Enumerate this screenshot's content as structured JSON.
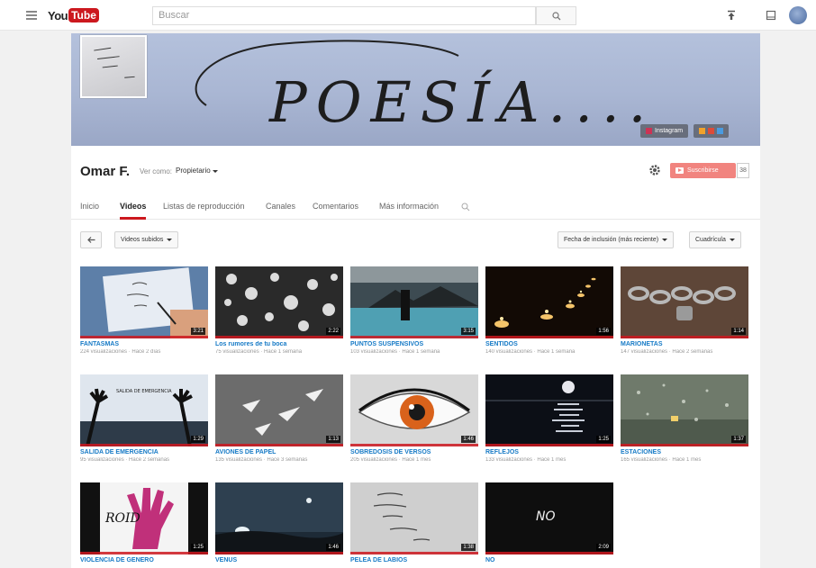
{
  "masthead": {
    "logo_you": "You",
    "logo_tube": "Tube",
    "search_placeholder": "Buscar"
  },
  "banner": {
    "text": "POESÍA....",
    "links": [
      {
        "label": "Instagram"
      },
      {
        "label": ""
      }
    ]
  },
  "channel": {
    "name": "Omar F.",
    "view_as_label": "Ver como:",
    "view_as_value": "Propietario",
    "subscribe_label": "Suscribirse",
    "subscriber_count": "38"
  },
  "tabs": [
    {
      "label": "Inicio"
    },
    {
      "label": "Videos"
    },
    {
      "label": "Listas de reproducción"
    },
    {
      "label": "Canales"
    },
    {
      "label": "Comentarios"
    },
    {
      "label": "Más información"
    }
  ],
  "toolbar": {
    "uploads_label": "Videos subidos",
    "sort_label": "Fecha de inclusión (más reciente)",
    "view_label": "Cuadrícula"
  },
  "videos": [
    {
      "title": "FANTASMAS",
      "meta": "224 visualizaciones · Hace 2 días",
      "duration": "3:21"
    },
    {
      "title": "Los rumores de tu boca",
      "meta": "75 visualizaciones · Hace 1 semana",
      "duration": "2:22"
    },
    {
      "title": "PUNTOS SUSPENSIVOS",
      "meta": "103 visualizaciones · Hace 1 semana",
      "duration": "3:15"
    },
    {
      "title": "SENTIDOS",
      "meta": "140 visualizaciones · Hace 1 semana",
      "duration": "1:56"
    },
    {
      "title": "MARIONETAS",
      "meta": "147 visualizaciones · Hace 2 semanas",
      "duration": "1:14"
    },
    {
      "title": "SALIDA DE EMERGENCIA",
      "meta": "95 visualizaciones · Hace 2 semanas",
      "duration": "1:29"
    },
    {
      "title": "AVIONES DE PAPEL",
      "meta": "135 visualizaciones · Hace 3 semanas",
      "duration": "1:13"
    },
    {
      "title": "SOBREDOSIS DE VERSOS",
      "meta": "205 visualizaciones · Hace 1 mes",
      "duration": "1:46"
    },
    {
      "title": "REFLEJOS",
      "meta": "133 visualizaciones · Hace 1 mes",
      "duration": "1:25"
    },
    {
      "title": "ESTACIONES",
      "meta": "165 visualizaciones · Hace 1 mes",
      "duration": "1:37"
    },
    {
      "title": "VIOLENCIA DE GENERO",
      "meta": "",
      "duration": "1:25"
    },
    {
      "title": "VENUS",
      "meta": "",
      "duration": "1:46"
    },
    {
      "title": "PELEA DE LABIOS",
      "meta": "",
      "duration": "1:38"
    },
    {
      "title": "NO",
      "meta": "",
      "duration": "2:09"
    }
  ],
  "thumb_texts": {
    "salida": "SALIDA DE EMERGENCIA",
    "violencia": "ROID",
    "no": "NO"
  }
}
